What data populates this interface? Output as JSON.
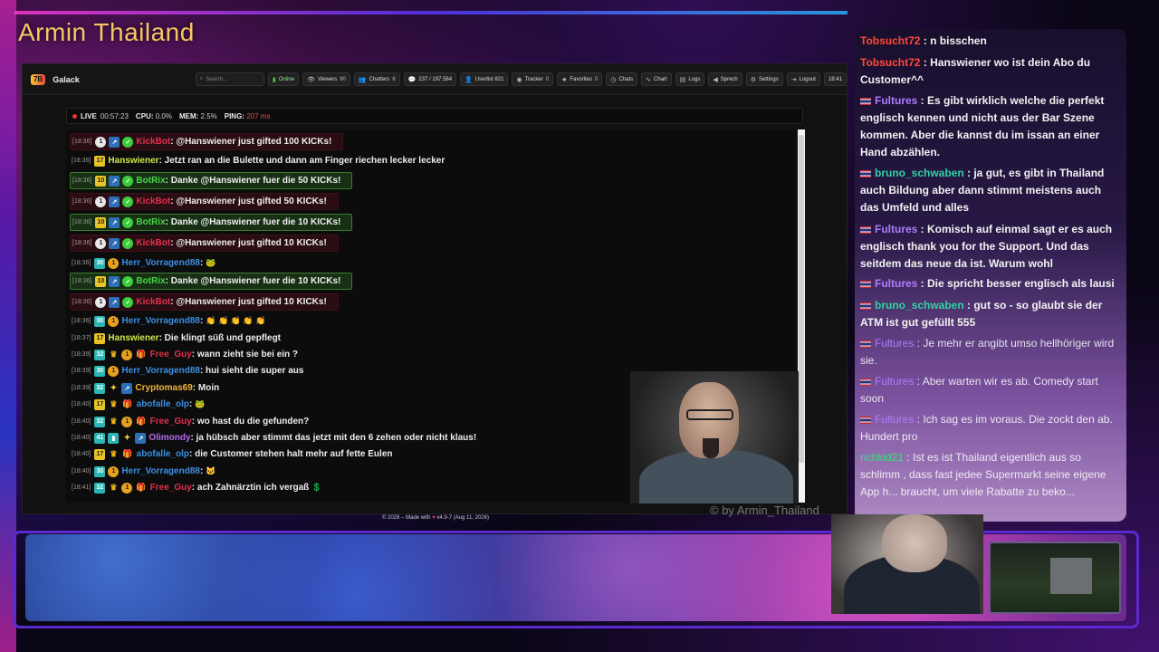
{
  "stream": {
    "title": "Armin Thailand",
    "watermark": "© by Armin_Thailand"
  },
  "navbar": {
    "logo": "7B",
    "brand": "Galack",
    "search_placeholder": "Search...",
    "buttons": [
      {
        "icon": "signal-icon",
        "glyph": "▮",
        "label": "Online"
      },
      {
        "icon": "viewers-icon",
        "glyph": "👁",
        "label": "Viewers",
        "count": "90"
      },
      {
        "icon": "chatters-icon",
        "glyph": "👥",
        "label": "Chatters",
        "count": "6"
      },
      {
        "icon": "messages-icon",
        "glyph": "💬",
        "label": "237 / 197.584"
      },
      {
        "icon": "userlist-icon",
        "glyph": "👤",
        "label": "Userlist 821"
      },
      {
        "icon": "tracker-icon",
        "glyph": "◉",
        "label": "Tracker",
        "count": "0"
      },
      {
        "icon": "favorites-icon",
        "glyph": "★",
        "label": "Favorites",
        "count": "0"
      },
      {
        "icon": "chats-icon",
        "glyph": "◷",
        "label": "Chats"
      },
      {
        "icon": "chart-icon",
        "glyph": "∿",
        "label": "Chart"
      },
      {
        "icon": "logs-icon",
        "glyph": "▤",
        "label": "Logs"
      },
      {
        "icon": "speech-icon",
        "glyph": "◀",
        "label": "Sprech"
      },
      {
        "icon": "settings-icon",
        "glyph": "⚙",
        "label": "Settings"
      },
      {
        "icon": "logout-icon",
        "glyph": "⇥",
        "label": "Logout"
      },
      {
        "icon": "clock-icon",
        "glyph": "",
        "label": "18:41"
      }
    ]
  },
  "status": {
    "live": "LIVE",
    "uptime": "00:57:23",
    "cpu_label": "CPU:",
    "cpu": "0.0%",
    "mem_label": "MEM:",
    "mem": "2.5%",
    "ping_label": "PING:",
    "ping": "207 ms"
  },
  "chat": [
    {
      "ts": "[18:36]",
      "style": "kick",
      "badges": [
        "white:1",
        "blue:↗",
        "green:✓"
      ],
      "user": "KickBot",
      "ucls": "n-kickbot",
      "text": ": @Hanswiener just gifted 100 KICKs!"
    },
    {
      "ts": "[18:36]",
      "style": "",
      "badges": [
        "yellow:17"
      ],
      "user": "Hanswiener",
      "ucls": "n-hansw",
      "text": ": Jetzt ran an die Bulette und dann am Finger riechen lecker lecker"
    },
    {
      "ts": "[18:36]",
      "style": "botrix",
      "badges": [
        "yellow:10",
        "blue:↗",
        "green:✓"
      ],
      "user": "BotRix",
      "ucls": "n-botrix",
      "text": ": Danke @Hanswiener fuer die 50 KICKs!"
    },
    {
      "ts": "[18:36]",
      "style": "kick",
      "badges": [
        "white:1",
        "blue:↗",
        "green:✓"
      ],
      "user": "KickBot",
      "ucls": "n-kickbot",
      "text": ": @Hanswiener just gifted 50 KICKs!"
    },
    {
      "ts": "[18:36]",
      "style": "botrix",
      "badges": [
        "yellow:10",
        "blue:↗",
        "green:✓"
      ],
      "user": "BotRix",
      "ucls": "n-botrix",
      "text": ": Danke @Hanswiener fuer die 10 KICKs!"
    },
    {
      "ts": "[18:36]",
      "style": "kick",
      "badges": [
        "white:1",
        "blue:↗",
        "green:✓"
      ],
      "user": "KickBot",
      "ucls": "n-kickbot",
      "text": ": @Hanswiener just gifted 10 KICKs!"
    },
    {
      "ts": "[18:36]",
      "style": "",
      "badges": [
        "teal:30",
        "orange:1"
      ],
      "user": "Herr_Vorragend88",
      "ucls": "n-herr",
      "text": ":",
      "emote": "🐸"
    },
    {
      "ts": "[18:36]",
      "style": "botrix",
      "badges": [
        "yellow:10",
        "blue:↗",
        "green:✓"
      ],
      "user": "BotRix",
      "ucls": "n-botrix",
      "text": ": Danke @Hanswiener fuer die 10 KICKs!"
    },
    {
      "ts": "[18:36]",
      "style": "kick",
      "badges": [
        "white:1",
        "blue:↗",
        "green:✓"
      ],
      "user": "KickBot",
      "ucls": "n-kickbot",
      "text": ": @Hanswiener just gifted 10 KICKs!"
    },
    {
      "ts": "[18:36]",
      "style": "",
      "badges": [
        "teal:30",
        "orange:1"
      ],
      "user": "Herr_Vorragend88",
      "ucls": "n-herr",
      "text": ":",
      "emote": "👏 👏 👏 👏 👏"
    },
    {
      "ts": "[18:37]",
      "style": "",
      "badges": [
        "yellow:17"
      ],
      "user": "Hanswiener",
      "ucls": "n-hansw",
      "text": ": Die klingt süß und gepflegt"
    },
    {
      "ts": "[18:39]",
      "style": "",
      "badges": [
        "teal:32",
        "crown:♛",
        "orange:1",
        "gift:🎁"
      ],
      "user": "Free_Guy",
      "ucls": "n-free",
      "text": ": wann zieht sie bei ein ?"
    },
    {
      "ts": "[18:39]",
      "style": "",
      "badges": [
        "teal:30",
        "orange:1"
      ],
      "user": "Herr_Vorragend88",
      "ucls": "n-herr",
      "text": ": hui sieht die super aus"
    },
    {
      "ts": "[18:39]",
      "style": "",
      "badges": [
        "teal:32",
        "star:✦",
        "blue:↗"
      ],
      "user": "Cryptomas69",
      "ucls": "n-crypto",
      "text": ": Moin"
    },
    {
      "ts": "[18:40]",
      "style": "",
      "badges": [
        "yellow:17",
        "crown:♛",
        "gift:🎁"
      ],
      "user": "abofalle_olp",
      "ucls": "n-abo",
      "text": ":",
      "emote": "🐸"
    },
    {
      "ts": "[18:40]",
      "style": "",
      "badges": [
        "teal:32",
        "crown:♛",
        "orange:1",
        "gift:🎁"
      ],
      "user": "Free_Guy",
      "ucls": "n-free",
      "text": ": wo hast du die gefunden?"
    },
    {
      "ts": "[18:40]",
      "style": "",
      "badges": [
        "teal:41",
        "teal:▮",
        "star:✦",
        "blue:↗"
      ],
      "user": "Olimondy",
      "ucls": "n-olli",
      "text": ": ja hübsch aber stimmt das jetzt mit den 6 zehen oder nicht klaus!"
    },
    {
      "ts": "[18:40]",
      "style": "",
      "badges": [
        "yellow:17",
        "crown:♛",
        "gift:🎁"
      ],
      "user": "abofalle_olp",
      "ucls": "n-abo",
      "text": ": die Customer stehen halt mehr auf fette Eulen"
    },
    {
      "ts": "[18:40]",
      "style": "",
      "badges": [
        "teal:30",
        "orange:1"
      ],
      "user": "Herr_Vorragend88",
      "ucls": "n-herr",
      "text": ":",
      "emote": "🐱"
    },
    {
      "ts": "[18:41]",
      "style": "",
      "badges": [
        "teal:32",
        "crown:♛",
        "orange:1",
        "gift:🎁"
      ],
      "user": "Free_Guy",
      "ucls": "n-free",
      "text": ": ach Zahnärztin ich vergaß",
      "emote": "💲"
    }
  ],
  "footer": {
    "text_before": "© 2026 – Made with",
    "text_after": "v4.9-7 (Aug 11, 2026)"
  },
  "side_chat": [
    {
      "flag": false,
      "user": "Tobsucht72",
      "ucls": "sc-user-red",
      "text": " : n bisschen",
      "faded": false
    },
    {
      "flag": false,
      "user": "Tobsucht72",
      "ucls": "sc-user-red",
      "text": " : Hanswiener wo ist dein Abo du Customer^^",
      "faded": false
    },
    {
      "flag": true,
      "user": "Fultures",
      "ucls": "sc-user-purple",
      "text": " : Es gibt wirklich welche die perfekt englisch kennen und nicht aus der Bar Szene kommen. Aber die kannst du im issan an einer Hand abzählen.",
      "faded": false
    },
    {
      "flag": true,
      "user": "bruno_schwaben",
      "ucls": "sc-user-teal",
      "text": " : ja gut, es gibt in Thailand auch Bildung aber dann stimmt meistens auch das Umfeld und alles",
      "faded": false
    },
    {
      "flag": true,
      "user": "Fultures",
      "ucls": "sc-user-purple",
      "text": " : Komisch auf einmal sagt er es auch englisch thank you for the Support. Und das seitdem das neue da ist. Warum wohl",
      "faded": false
    },
    {
      "flag": true,
      "user": "Fultures",
      "ucls": "sc-user-purple",
      "text": " : Die spricht besser englisch als lausi",
      "faded": false
    },
    {
      "flag": true,
      "user": "bruno_schwaben",
      "ucls": "sc-user-teal",
      "text": " : gut so - so glaubt sie der ATM ist gut gefüllt 555",
      "faded": false
    },
    {
      "flag": true,
      "user": "Fultures",
      "ucls": "sc-user-purple",
      "text": " : Je mehr er angibt umso hellhöriger wird sie.",
      "faded": true
    },
    {
      "flag": true,
      "user": "Fultures",
      "ucls": "sc-user-purple",
      "text": " : Aber warten wir es ab. Comedy start soon",
      "faded": true
    },
    {
      "flag": true,
      "user": "Fultures",
      "ucls": "sc-user-purple",
      "text": " : Ich sag es im voraus. Die zockt den ab. Hundert pro",
      "faded": true
    },
    {
      "flag": false,
      "user": "richkid21",
      "ucls": "sc-user-green",
      "text": " : Ist es ist Thailand eigentlich aus so schlimm , dass fast jedee Supermarkt seine eigene App h... braucht, um viele Rabatte zu beko...",
      "faded": true
    }
  ]
}
